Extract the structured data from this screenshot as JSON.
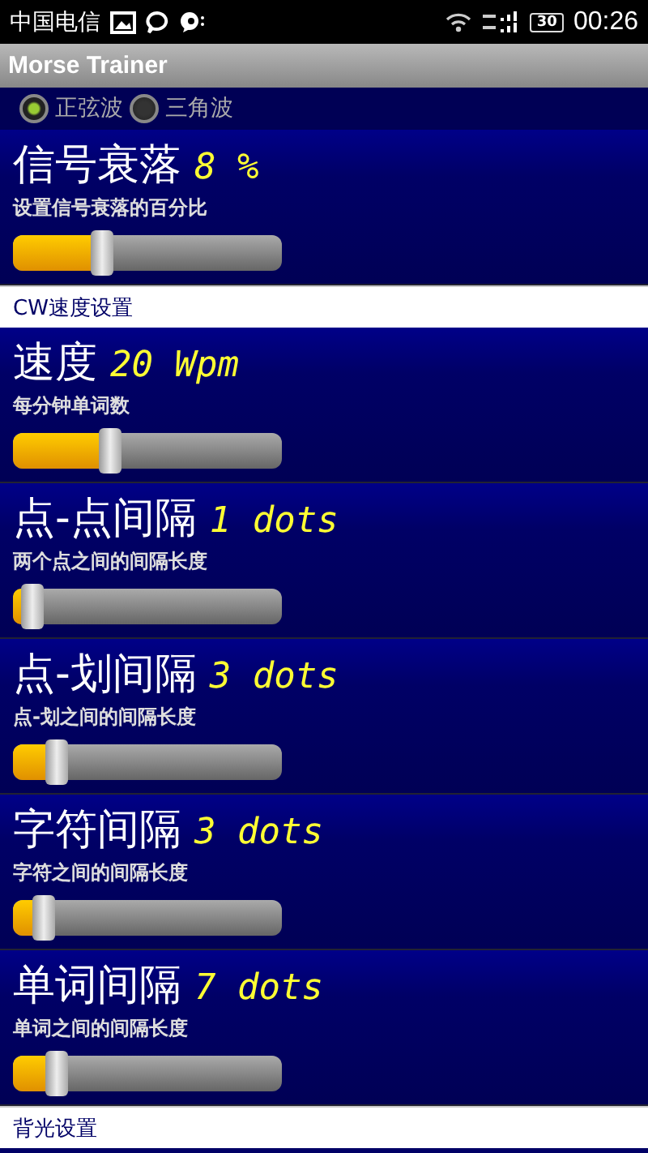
{
  "status_bar": {
    "carrier": "中国电信",
    "battery": "30",
    "time": "00:26"
  },
  "window": {
    "title": "Morse Trainer"
  },
  "wave_options": [
    {
      "label": "正弦波",
      "selected": true
    },
    {
      "label": "三角波",
      "selected": false
    }
  ],
  "sections": [
    {
      "kind": "setting",
      "title": "信号衰落",
      "value": "8 %",
      "description": "设置信号衰落的百分比",
      "level": 0.29
    },
    {
      "kind": "header",
      "title": "CW速度设置"
    },
    {
      "kind": "setting",
      "title": "速度",
      "value": "20 Wpm",
      "description": "每分钟单词数",
      "level": 0.32
    },
    {
      "kind": "setting",
      "title": "点-点间隔",
      "value": "1 dots",
      "description": "两个点之间的间隔长度",
      "level": 0.03
    },
    {
      "kind": "setting",
      "title": "点-划间隔",
      "value": "3 dots",
      "description": "点-划之间的间隔长度",
      "level": 0.12
    },
    {
      "kind": "setting",
      "title": "字符间隔",
      "value": "3 dots",
      "description": "字符之间的间隔长度",
      "level": 0.07
    },
    {
      "kind": "setting",
      "title": "单词间隔",
      "value": "7 dots",
      "description": "单词之间的间隔长度",
      "level": 0.12
    },
    {
      "kind": "header",
      "title": "背光设置"
    }
  ]
}
